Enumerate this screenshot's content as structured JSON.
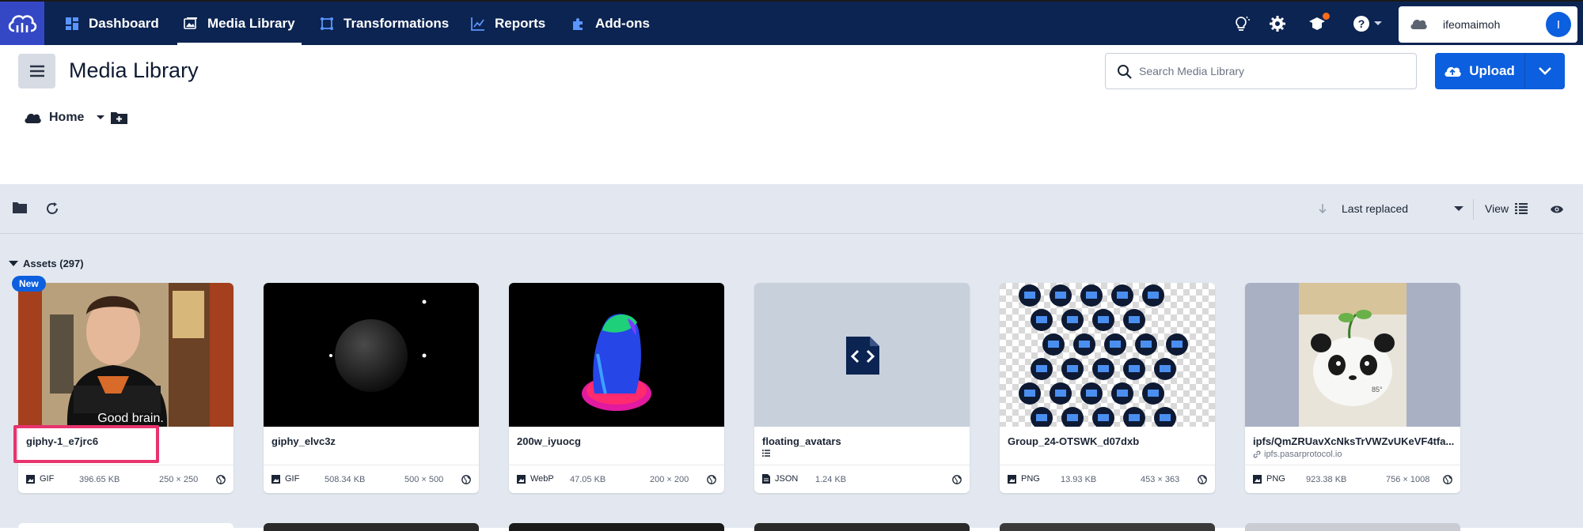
{
  "nav": {
    "items": [
      {
        "label": "Dashboard",
        "icon": "dashboard-icon"
      },
      {
        "label": "Media Library",
        "icon": "image-icon"
      },
      {
        "label": "Transformations",
        "icon": "transform-icon"
      },
      {
        "label": "Reports",
        "icon": "chart-icon"
      },
      {
        "label": "Add-ons",
        "icon": "puzzle-icon"
      }
    ],
    "account_name": "ifeomaimoh",
    "avatar_initial": "I"
  },
  "header": {
    "title": "Media Library",
    "search_placeholder": "Search Media Library",
    "upload_label": "Upload"
  },
  "breadcrumb": {
    "home_label": "Home"
  },
  "toolbar": {
    "sort_label": "Last replaced",
    "view_label": "View"
  },
  "assets": {
    "heading": "Assets (297)",
    "new_badge": "New",
    "items": [
      {
        "name": "giphy-1_e7jrc6",
        "type": "GIF",
        "size": "396.65 KB",
        "dims": "250 × 250",
        "caption": "Good brain."
      },
      {
        "name": "giphy_elvc3z",
        "type": "GIF",
        "size": "508.34 KB",
        "dims": "500 × 500"
      },
      {
        "name": "200w_iyuocg",
        "type": "WebP",
        "size": "47.05 KB",
        "dims": "200 × 200"
      },
      {
        "name": "floating_avatars",
        "type": "JSON",
        "size": "1.24 KB",
        "dims": ""
      },
      {
        "name": "Group_24-OTSWK_d07dxb",
        "type": "PNG",
        "size": "13.93 KB",
        "dims": "453 × 363"
      },
      {
        "name": "ipfs/QmZRUavXcNksTrVWZvUKeVF4tfa...",
        "type": "PNG",
        "size": "923.38 KB",
        "dims": "756 × 1008",
        "source": "ipfs.pasarprotocol.io",
        "photo_text": "85°"
      }
    ]
  },
  "colors": {
    "nav_bg": "#0c2452",
    "accent": "#0c5fde",
    "highlight": "#e8336d",
    "gray_area": "#e3e8f0"
  }
}
